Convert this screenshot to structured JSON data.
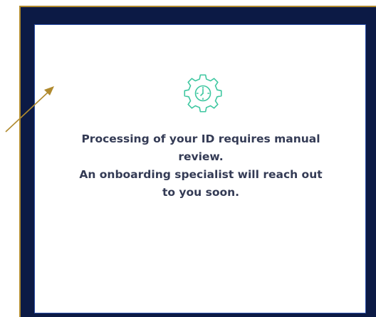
{
  "dialog": {
    "icon": "gear-clock-icon",
    "message_line1": "Processing of your ID requires manual review.",
    "message_line2": "An onboarding specialist will reach out to you soon."
  },
  "colors": {
    "frame": "#0c1a45",
    "frame_border": "#b08a2e",
    "card_border": "#2b4fa8",
    "icon": "#3ec7a0",
    "text": "#343b55",
    "arrow": "#b08a2e"
  },
  "annotation": {
    "icon": "arrow-pointer-icon"
  }
}
